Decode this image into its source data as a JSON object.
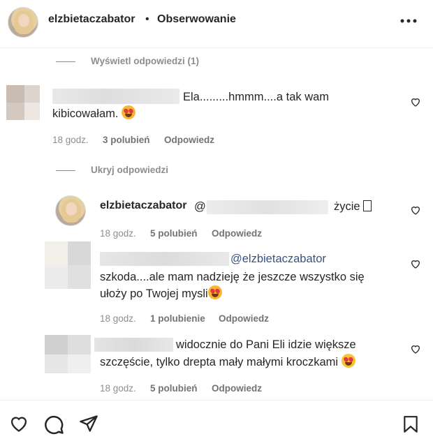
{
  "header": {
    "username": "elzbietaczabator",
    "separator": "•",
    "follow_label": "Obserwowanie",
    "more_icon": "more-horizontal-icon"
  },
  "thread": {
    "view_replies_label": "Wyświetl odpowiedzi (1)",
    "hide_replies_label": "Ukryj odpowiedzi"
  },
  "comments": [
    {
      "text_line1": "Ela.........hmmm....a tak wam",
      "text_line2": "kibicowałam.",
      "time": "18 godz.",
      "likes": "3 polubień",
      "reply_label": "Odpowiedz"
    },
    {
      "username": "elzbietaczabator",
      "mention_prefix": "@",
      "text": "życie",
      "time": "18 godz.",
      "likes": "5 polubień",
      "reply_label": "Odpowiedz"
    },
    {
      "mention": "@elzbietaczabator",
      "text_line1": "szkoda....ale mam nadzieję że jeszcze wszystko się",
      "text_line2": "ułoży po Twojej mysli",
      "time": "18 godz.",
      "likes": "1 polubienie",
      "reply_label": "Odpowiedz"
    },
    {
      "text_line1": "widocznie do Pani Eli idzie większe",
      "text_line2": "szczęście, tylko drepta mały małymi kroczkami",
      "time": "18 godz.",
      "likes": "5 polubień",
      "reply_label": "Odpowiedz"
    }
  ],
  "actions": {
    "like_icon": "heart-icon",
    "comment_icon": "comment-icon",
    "share_icon": "send-icon",
    "save_icon": "bookmark-icon"
  }
}
